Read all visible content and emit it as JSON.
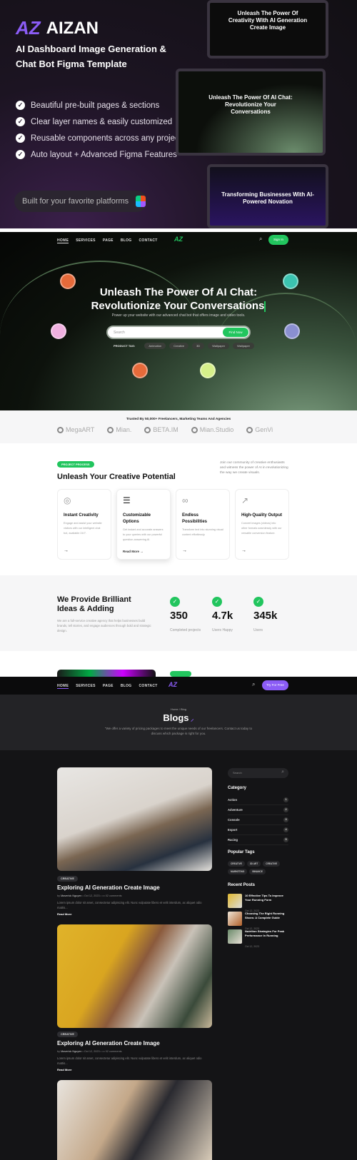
{
  "promo": {
    "brand": "AIZAN",
    "brand_mark": "AZ",
    "title": "AI Dashboard Image Generation & Chat Bot Figma Template",
    "features": [
      "Beautiful pre-built pages & sections",
      "Clear layer names & easily customized",
      "Reusable components across any project",
      "Auto layout + Advanced Figma Features"
    ],
    "platforms": "Built for your favorite platforms",
    "mockups": [
      "Unleash The Power Of Creativity With AI Generation Create Image",
      "Unleash The Power Of AI Chat: Revolutionize Your Conversations",
      "Transforming Businesses With AI-Powered Novation"
    ]
  },
  "chat": {
    "nav": [
      "HOME",
      "SERVICES",
      "PAGE",
      "BLOG",
      "CONTACT"
    ],
    "logo": "AZ",
    "signin": "Sign In",
    "hero_title_1": "Unleash The Power Of AI Chat:",
    "hero_title_2": "Revolutionize Your Conversations",
    "hero_sub": "Power up your website with our advanced chat bot that offers image and video tools.",
    "search_placeholder": "Search",
    "find": "Find Now",
    "tag_label": "PRODUCT TAG:",
    "tags": [
      "Animation",
      "Creative",
      "3D",
      "Wallpaper",
      "Wallpaper"
    ],
    "trusted": "Trusted By 50,000+ Freelancers, Marketing Teams And Agencies",
    "brands": [
      "MegaART",
      "Mian.",
      "BETA.IM",
      "Mian.Studio",
      "GenVi"
    ],
    "process_pill": "PROJECT PROCESS",
    "process_title": "Unleash Your Creative Potential",
    "process_desc": "Join our community of creative enthusiasts and witness the power of AI in revolutionizing the way we create visuals.",
    "cards": [
      {
        "title": "Instant Creativity",
        "text": "Engage and assist your website visitors with our intelligent chat bot, available 24/7.",
        "icon": "lightbulb-icon"
      },
      {
        "title": "Customizable Options",
        "text": "Get instant and accurate answers to your queries with our powerful question-answering AI.",
        "icon": "sliders-icon",
        "link": "Read More"
      },
      {
        "title": "Endless Possibilities",
        "text": "Transform text into stunning visual content effortlessly.",
        "icon": "infinity-icon"
      },
      {
        "title": "High-Quality Output",
        "text": "Convert images (videos) into other formats seamlessly with our versatile conversion feature.",
        "icon": "share-icon"
      }
    ],
    "ideas_title": "We Provide Brilliant Ideas & Adding",
    "ideas_text": "We are a full-service creative agency that helps businesses build brands, tell stories, and engage audiences through bold and strategic design.",
    "stats": [
      {
        "value": "350",
        "label": "Completed projects"
      },
      {
        "value": "4.7k",
        "label": "Users Happy"
      },
      {
        "value": "345k",
        "label": "Users"
      }
    ]
  },
  "blog": {
    "nav": [
      "HOME",
      "SERVICES",
      "PAGE",
      "BLOG",
      "CONTACT"
    ],
    "logo": "AZ",
    "cta": "Try For Free",
    "breadcrumb": "Home / Blog",
    "title": "Blogs",
    "desc": "\"We offer a variety of pricing packages to meet the unique needs of our freelancers. Contact us today to discuss which package is right for you.",
    "posts": [
      {
        "tag": "CREATIVE",
        "title": "Exploring AI Generation Create Image",
        "by": "by",
        "author": "Maverick Nguyen",
        "date": "Oct 12, 2023",
        "comments": "02 comments",
        "excerpt": "Lorem ipsum dolor sit amet, consectetur adipiscing elit. Nunc vulputate libero et velit interdum, ac aliquet odio mattis...",
        "more": "Read More"
      },
      {
        "tag": "CREATIVE",
        "title": "Exploring AI Generation Create Image",
        "by": "by",
        "author": "Maverick Nguyen",
        "date": "Oct 12, 2023",
        "comments": "02 comments",
        "excerpt": "Lorem ipsum dolor sit amet, consectetur adipiscing elit. Nunc vulputate libero et velit interdum, ac aliquet odio mattis...",
        "more": "Read More"
      }
    ],
    "search_placeholder": "Search",
    "category_title": "Category",
    "categories": [
      {
        "name": "Action",
        "count": "1"
      },
      {
        "name": "Adventure",
        "count": "2"
      },
      {
        "name": "Console",
        "count": "3"
      },
      {
        "name": "Esport",
        "count": "4"
      },
      {
        "name": "Racing",
        "count": "5"
      }
    ],
    "tags_title": "Popular Tags",
    "tags": [
      "CREATIVE",
      "3D ART",
      "CREATIVE",
      "MARKETING",
      "BINANCE"
    ],
    "recent_title": "Recent Posts",
    "recent": [
      {
        "title": "10 Effective Tips To Improve Your Running Form",
        "date": "Oct 12, 2023"
      },
      {
        "title": "Choosing The Right Running Shoes: A Complete Guide",
        "date": "Oct 12, 2023"
      },
      {
        "title": "Nutrition Strategies For Peak Performance In Running",
        "date": "Oct 12, 2023"
      }
    ]
  },
  "colors": {
    "green": "#22c55e",
    "purple": "#8b5cf6"
  }
}
